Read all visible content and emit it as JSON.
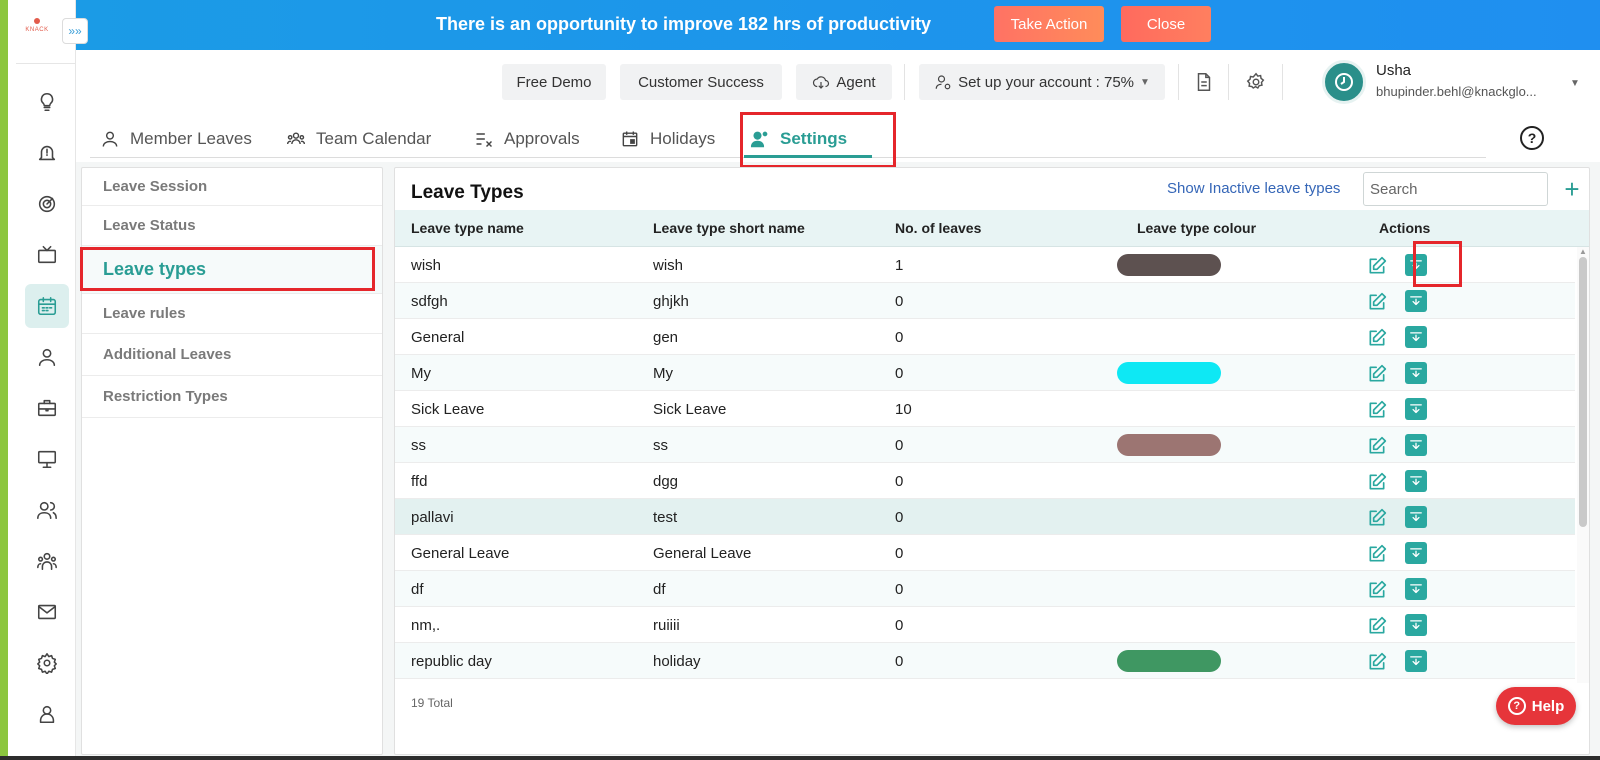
{
  "banner": {
    "message": "There is an opportunity to improve 182 hrs of productivity",
    "take_action_label": "Take Action",
    "close_label": "Close"
  },
  "sidebar": {
    "logo_text": "KNACK",
    "expand_glyph": "»»",
    "icons": [
      "lightbulb-icon",
      "bell-alert-icon",
      "target-icon",
      "tv-icon",
      "calendar-icon",
      "user-icon",
      "briefcase-icon",
      "monitor-icon",
      "users-icon",
      "team-icon",
      "mail-icon",
      "gear-icon",
      "profile-icon"
    ],
    "active_icon": "calendar-icon"
  },
  "header": {
    "free_demo_label": "Free Demo",
    "customer_success_label": "Customer Success",
    "agent_label": "Agent",
    "setup_label": "Set up your account : 75%",
    "user_name": "Usha",
    "user_email": "bhupinder.behl@knackglo..."
  },
  "tabs": [
    {
      "label": "Member Leaves"
    },
    {
      "label": "Team Calendar"
    },
    {
      "label": "Approvals"
    },
    {
      "label": "Holidays"
    },
    {
      "label": "Settings"
    }
  ],
  "settings_menu": [
    {
      "label": "Leave Session"
    },
    {
      "label": "Leave Status"
    },
    {
      "label": "Leave types"
    },
    {
      "label": "Leave rules"
    },
    {
      "label": "Additional Leaves"
    },
    {
      "label": "Restriction Types"
    }
  ],
  "leave_types": {
    "title": "Leave Types",
    "inactive_link": "Show Inactive leave types",
    "search_placeholder": "Search",
    "add_glyph": "+",
    "columns": [
      "Leave type name",
      "Leave type short name",
      "No. of leaves",
      "Leave type colour",
      "Actions"
    ],
    "rows": [
      {
        "name": "wish",
        "short": "wish",
        "count": "1",
        "colour": "#5d5150"
      },
      {
        "name": "sdfgh",
        "short": "ghjkh",
        "count": "0",
        "colour": ""
      },
      {
        "name": "General",
        "short": "gen",
        "count": "0",
        "colour": ""
      },
      {
        "name": "My",
        "short": "My",
        "count": "0",
        "colour": "#0ee8f4"
      },
      {
        "name": "Sick Leave",
        "short": "Sick Leave",
        "count": "10",
        "colour": ""
      },
      {
        "name": "ss",
        "short": "ss",
        "count": "0",
        "colour": "#9c7572"
      },
      {
        "name": "ffd",
        "short": "dgg",
        "count": "0",
        "colour": ""
      },
      {
        "name": "pallavi",
        "short": "test",
        "count": "0",
        "colour": ""
      },
      {
        "name": "General Leave",
        "short": "General Leave",
        "count": "0",
        "colour": ""
      },
      {
        "name": "df",
        "short": "df",
        "count": "0",
        "colour": ""
      },
      {
        "name": "nm,.",
        "short": "ruiiii",
        "count": "0",
        "colour": ""
      },
      {
        "name": "republic day",
        "short": "holiday",
        "count": "0",
        "colour": "#3f9762"
      }
    ],
    "total": "19 Total"
  },
  "help_label": "Help",
  "colors": {
    "accent": "#2a9d94",
    "banner": "#1b9be6",
    "highlight_box": "#e5262b",
    "help": "#e6353a"
  }
}
